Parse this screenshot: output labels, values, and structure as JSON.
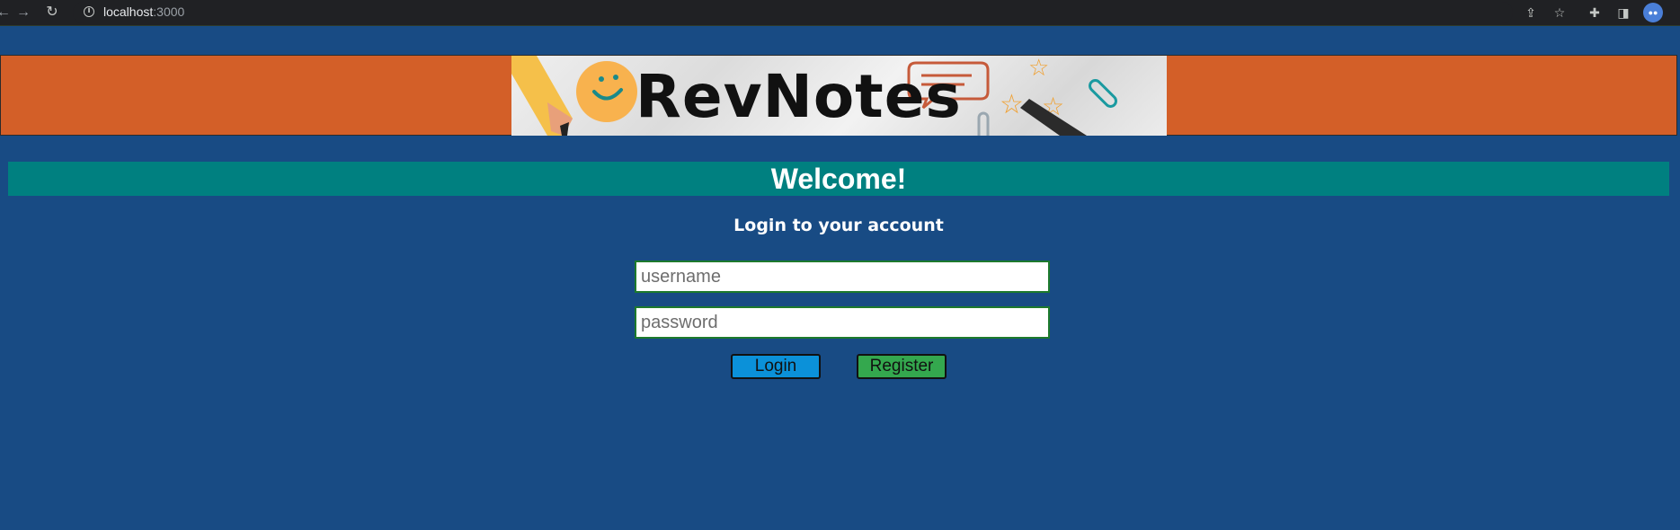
{
  "browser": {
    "url_host": "localhost",
    "url_port": ":3000"
  },
  "banner": {
    "logo_text": "RevNotes",
    "background_color": "#d35f28"
  },
  "main": {
    "welcome_title": "Welcome!",
    "subtitle": "Login to your account",
    "username_placeholder": "username",
    "password_placeholder": "password",
    "login_label": "Login",
    "register_label": "Register"
  },
  "colors": {
    "page_background": "#184b84",
    "welcome_bar": "#008080",
    "login_button": "#0b91d9",
    "register_button": "#34a84e"
  }
}
